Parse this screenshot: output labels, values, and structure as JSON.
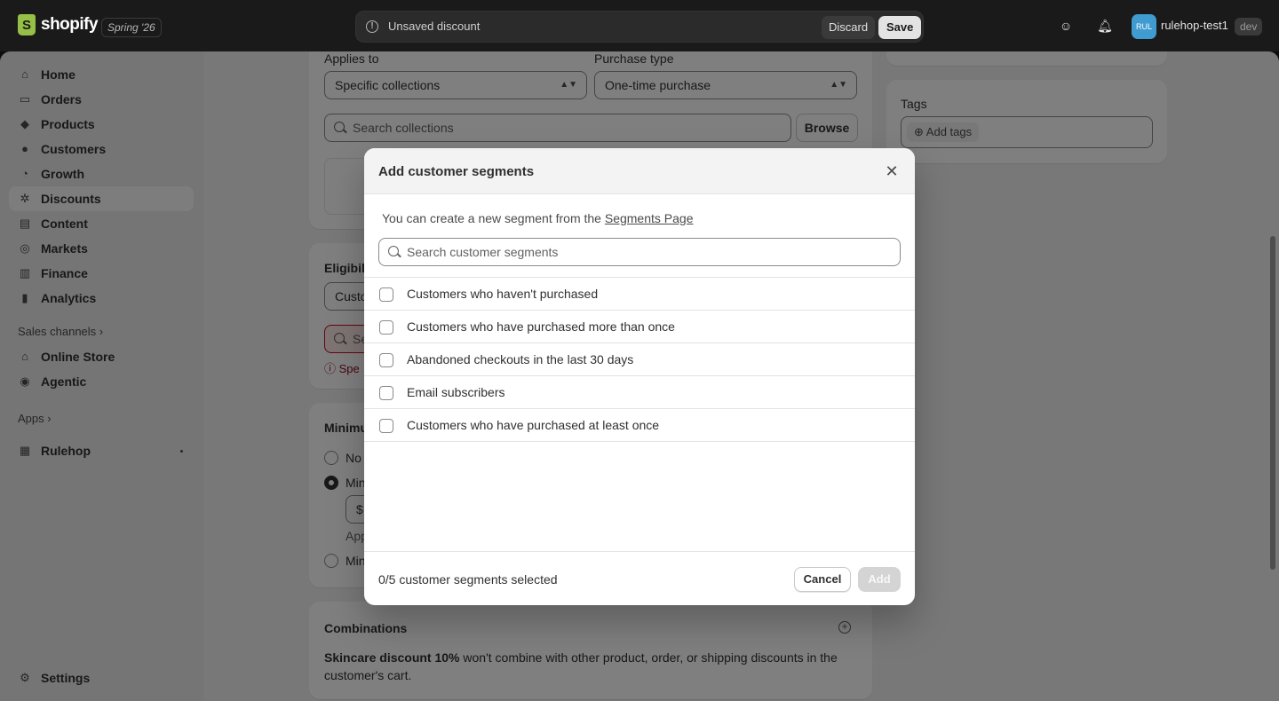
{
  "topbar": {
    "logo_text": "shopify",
    "edition": "Spring '26",
    "unsaved_text": "Unsaved discount",
    "discard_label": "Discard",
    "save_label": "Save",
    "store_initials": "RUL",
    "store_name": "rulehop-test1",
    "store_badge": "dev"
  },
  "sidebar": {
    "items": [
      {
        "label": "Home",
        "icon": "home-icon"
      },
      {
        "label": "Orders",
        "icon": "inbox-icon"
      },
      {
        "label": "Products",
        "icon": "tag-icon"
      },
      {
        "label": "Customers",
        "icon": "person-icon"
      },
      {
        "label": "Growth",
        "icon": "growth-icon"
      },
      {
        "label": "Discounts",
        "icon": "discount-icon"
      },
      {
        "label": "Content",
        "icon": "content-icon"
      },
      {
        "label": "Markets",
        "icon": "globe-icon"
      },
      {
        "label": "Finance",
        "icon": "bank-icon"
      },
      {
        "label": "Analytics",
        "icon": "bar-chart-icon"
      }
    ],
    "sales_channels_label": "Sales channels",
    "channels": [
      {
        "label": "Online Store",
        "icon": "store-icon"
      },
      {
        "label": "Agentic",
        "icon": "agentic-icon"
      }
    ],
    "apps_label": "Apps",
    "apps": [
      {
        "label": "Rulehop",
        "icon": "app-grid-icon"
      }
    ],
    "settings_label": "Settings"
  },
  "main": {
    "applies_to_label": "Applies to",
    "applies_to_value": "Specific collections",
    "purchase_type_label": "Purchase type",
    "purchase_type_value": "One-time purchase",
    "collections_placeholder": "Search collections",
    "browse_label": "Browse",
    "eligibility_label": "Eligibili",
    "eligibility_select": "Custo",
    "eligibility_search": "Se",
    "eligibility_error": "Spe",
    "minimum_label": "Minimu",
    "minimum_opt1": "No",
    "minimum_opt2": "Min",
    "minimum_input": "$",
    "minimum_help": "App",
    "minimum_opt3": "Min",
    "combinations_title": "Combinations",
    "combinations_bold": "Skincare discount 10%",
    "combinations_text": " won't combine with other product, order, or shipping discounts in the customer's cart.",
    "tags_label": "Tags",
    "add_tags_label": "Add tags"
  },
  "modal": {
    "title": "Add customer segments",
    "hint_text": "You can create a new segment from the ",
    "hint_link": "Segments Page",
    "search_placeholder": "Search customer segments",
    "segments": [
      {
        "label": "Customers who haven't purchased",
        "checked": false
      },
      {
        "label": "Customers who have purchased more than once",
        "checked": false
      },
      {
        "label": "Abandoned checkouts in the last 30 days",
        "checked": false
      },
      {
        "label": "Email subscribers",
        "checked": false
      },
      {
        "label": "Customers who have purchased at least once",
        "checked": false
      }
    ],
    "selected_count": "0/5 customer segments selected",
    "cancel_label": "Cancel",
    "add_label": "Add"
  }
}
